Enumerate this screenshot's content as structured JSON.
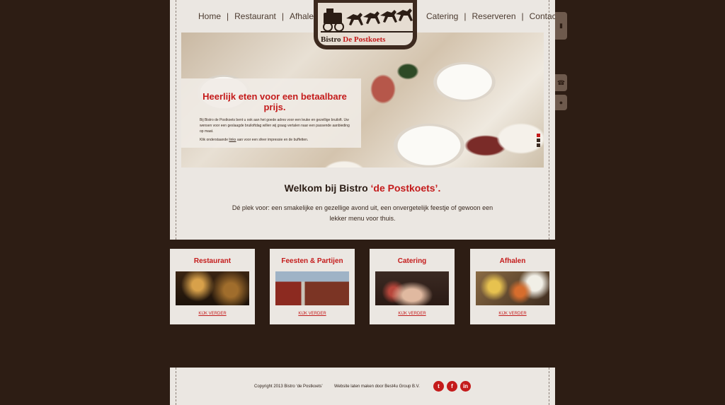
{
  "nav": {
    "home": "Home",
    "restaurant": "Restaurant",
    "afhalen": "Afhalen",
    "catering": "Catering",
    "reserveren": "Reserveren",
    "contact": "Contact",
    "separator": "|"
  },
  "logo": {
    "text_prefix": "Bistro",
    "text_highlight": "De Postkoets"
  },
  "slider": {
    "title": "Heerlijk eten voor een betaalbare prijs.",
    "paragraph1": "Bij Bistro de Postkoets bent u ook aan het goede adres voor een leuke en gezellige bruiloft. Uw wensen voor een geslaagde bruiloftdag willen wij graag vertalen naar een passende aanbieding op maat.",
    "paragraph2_before": "Klik onderstaande",
    "paragraph2_link": "links",
    "paragraph2_after": "aan voor een sfeer impressie en de buffetten.",
    "active_slide": 1,
    "slide_count": 3
  },
  "welcome": {
    "title_prefix": "Welkom bij Bistro",
    "title_highlight": "‘de Postkoets’.",
    "text": "Dé plek voor: een smakelijke en gezellige avond uit, een onvergetelijk feestje of gewoon een lekker menu voor thuis."
  },
  "cards": [
    {
      "title": "Restaurant",
      "link": "KIJK VERDER"
    },
    {
      "title": "Feesten & Partijen",
      "link": "KIJK VERDER"
    },
    {
      "title": "Catering",
      "link": "KIJK VERDER"
    },
    {
      "title": "Afhalen",
      "link": "KIJK VERDER"
    }
  ],
  "footer": {
    "copyright": "Copyright 2013 Bistro ‘de Postkoets’",
    "credit": "Website laten maken door Best4u Group B.V.",
    "social": [
      "twitter-icon",
      "facebook-icon",
      "linkedin-icon"
    ]
  },
  "colors": {
    "background": "#2d1d14",
    "panel": "#ebe7e2",
    "accent": "#c41b1b"
  }
}
